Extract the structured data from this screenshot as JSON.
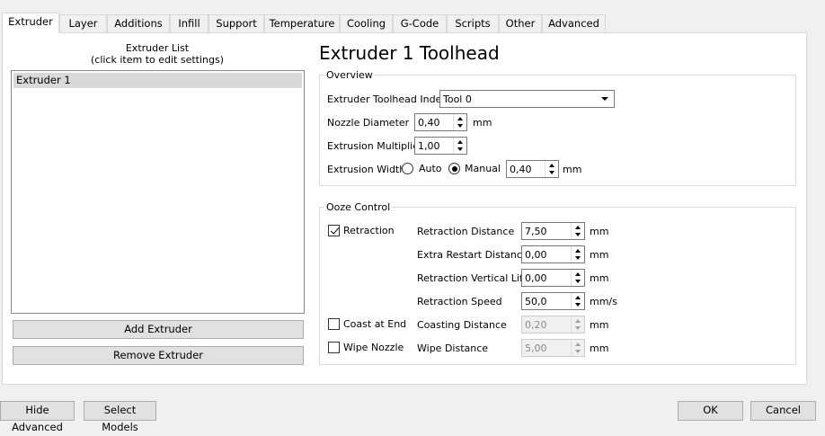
{
  "tabs": [
    "Extruder",
    "Layer",
    "Additions",
    "Infill",
    "Support",
    "Temperature",
    "Cooling",
    "G-Code",
    "Scripts",
    "Other",
    "Advanced"
  ],
  "extruder_list": {
    "caption_line1": "Extruder List",
    "caption_line2": "(click item to edit settings)",
    "items": [
      "Extruder 1"
    ],
    "add_label": "Add Extruder",
    "remove_label": "Remove Extruder"
  },
  "toolhead": {
    "title": "Extruder 1 Toolhead",
    "overview_title": "Overview",
    "index_label": "Extruder Toolhead Index",
    "index_value": "Tool 0",
    "nozzle_label": "Nozzle Diameter",
    "nozzle_value": "0,40",
    "nozzle_unit": "mm",
    "multiplier_label": "Extrusion Multiplier",
    "multiplier_value": "1,00",
    "width_label": "Extrusion Width",
    "width_auto": "Auto",
    "width_manual": "Manual",
    "width_value": "0,40",
    "width_unit": "mm"
  },
  "ooze": {
    "title": "Ooze Control",
    "retraction_label": "Retraction",
    "coast_label": "Coast at End",
    "wipe_label": "Wipe Nozzle",
    "retraction_distance_label": "Retraction Distance",
    "retraction_distance_value": "7,50",
    "extra_restart_label": "Extra Restart Distance",
    "extra_restart_value": "0,00",
    "vertical_lift_label": "Retraction Vertical Lift",
    "vertical_lift_value": "0,00",
    "retraction_speed_label": "Retraction Speed",
    "retraction_speed_value": "50,0",
    "coasting_distance_label": "Coasting Distance",
    "coasting_distance_value": "0,20",
    "wipe_distance_label": "Wipe Distance",
    "wipe_distance_value": "5,00",
    "unit_mm": "mm",
    "unit_mms": "mm/s"
  },
  "footer": {
    "hide_advanced": "Hide Advanced",
    "select_models": "Select Models",
    "ok": "OK",
    "cancel": "Cancel"
  }
}
